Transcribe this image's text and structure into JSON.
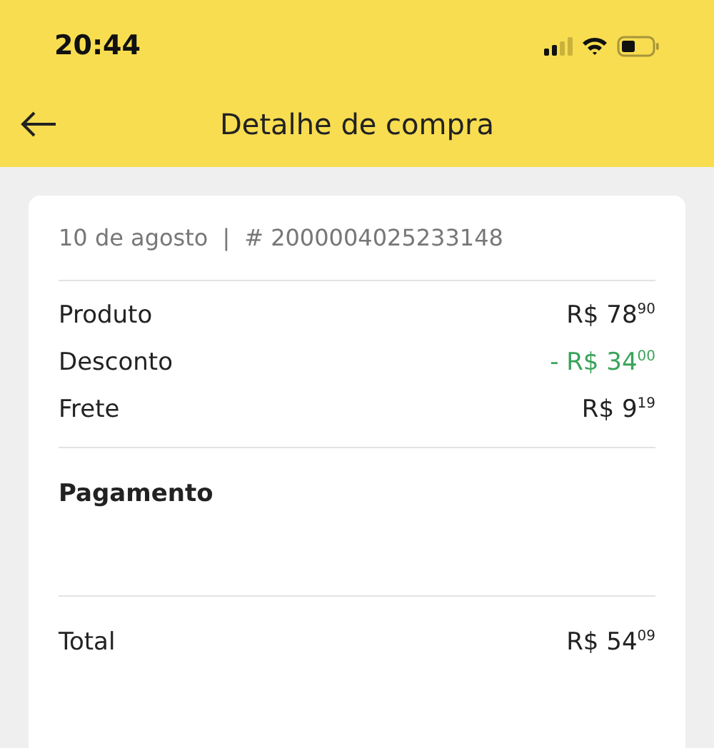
{
  "status_bar": {
    "time": "20:44"
  },
  "header": {
    "title": "Detalhe de compra"
  },
  "order": {
    "date": "10 de agosto",
    "separator": "|",
    "number": "# 2000004025233148"
  },
  "lines": [
    {
      "label": "Produto",
      "amount": "R$ 78$^{90}$",
      "kind": "charge"
    },
    {
      "label": "Desconto",
      "amount": "- R$ 34$^{00}$",
      "kind": "discount"
    },
    {
      "label": "Frete",
      "amount": "R$ 9$^{19}$",
      "kind": "charge"
    }
  ],
  "payment": {
    "title": "Pagamento"
  },
  "total": {
    "label": "Total",
    "amount": "R$ 54$^{09}$"
  }
}
